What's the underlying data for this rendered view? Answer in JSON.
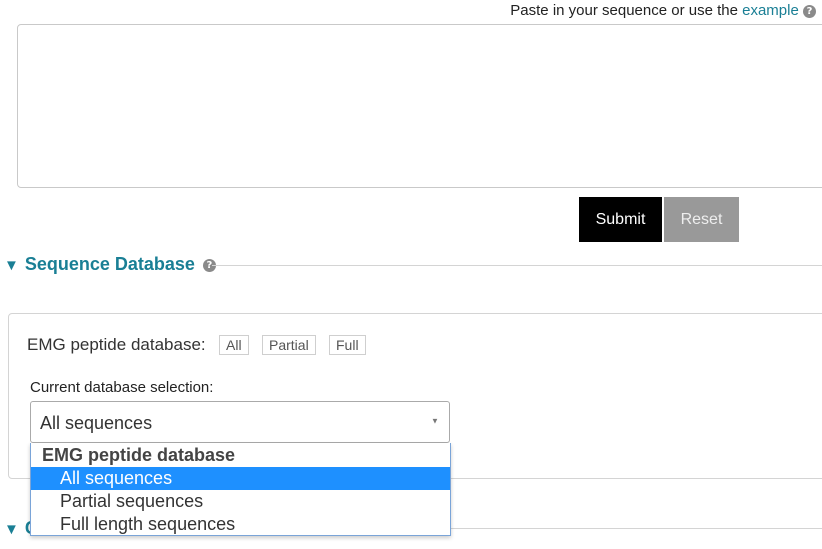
{
  "input": {
    "prompt": "Paste in your sequence or use the",
    "example_link": "example",
    "help_icon_glyph": "?",
    "textarea_value": ""
  },
  "actions": {
    "submit_label": "Submit",
    "reset_label": "Reset"
  },
  "sequence_database": {
    "heading": "Sequence Database",
    "heading_toggle_glyph": "▼",
    "help_icon_glyph": "?",
    "emg_label": "EMG peptide database:",
    "filters": [
      "All",
      "Partial",
      "Full"
    ],
    "current_label": "Current database selection:",
    "selected_value": "All sequences",
    "dropdown_arrow_glyph": "▼",
    "dropdown": {
      "group_label": "EMG peptide database",
      "options": [
        "All sequences",
        "Partial sequences",
        "Full length sequences"
      ],
      "highlighted_index": 0
    }
  },
  "next_section": {
    "toggle_glyph": "▼",
    "heading_partial": "C"
  },
  "colors": {
    "accent": "#1a7f95",
    "submit_bg": "#000000",
    "reset_bg": "#999999",
    "highlight": "#1e90ff"
  }
}
